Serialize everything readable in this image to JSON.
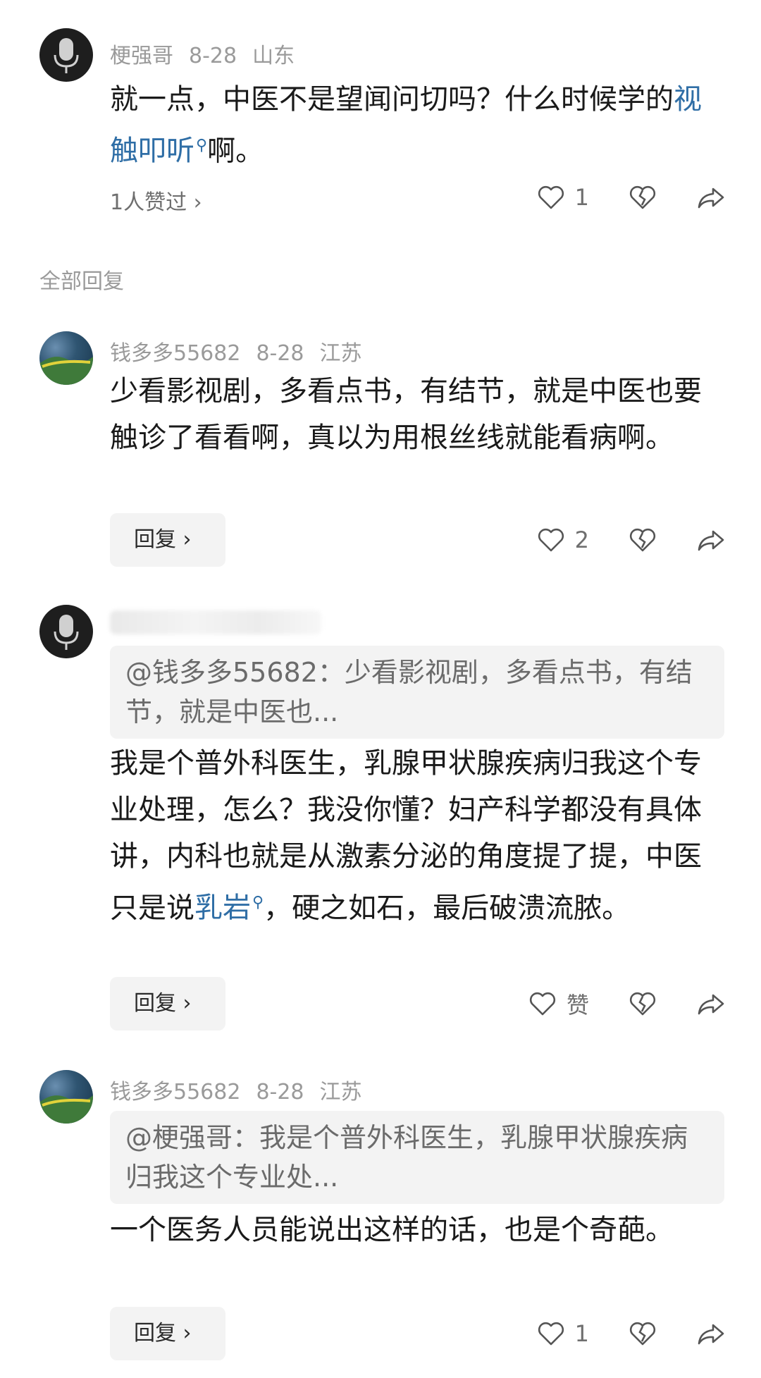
{
  "comments": [
    {
      "author": "梗强哥",
      "date": "8-28",
      "location": "山东",
      "text_pre": "就一点，中医不是望闻问切吗？什么时候学的",
      "link": "视触叩听",
      "text_post": "啊。",
      "likes_line": "1人赞过 ›",
      "like_count": "1"
    },
    {
      "author": "钱多多55682",
      "date": "8-28",
      "location": "江苏",
      "text": "少看影视剧，多看点书，有结节，就是中医也要触诊了看看啊，真以为用根丝线就能看病啊。",
      "reply_label": "回复 ›",
      "like_count": "2"
    },
    {
      "quote": "@钱多多55682：少看影视剧，多看点书，有结节，就是中医也...",
      "text_pre": "我是个普外科医生，乳腺甲状腺疾病归我这个专业处理，怎么？我没你懂？妇产科学都没有具体讲，内科也就是从激素分泌的角度提了提，中医只是说",
      "link": "乳岩",
      "text_post": "，硬之如石，最后破溃流脓。",
      "reply_label": "回复 ›",
      "like_label": "赞"
    },
    {
      "author": "钱多多55682",
      "date": "8-28",
      "location": "江苏",
      "quote": "@梗强哥：我是个普外科医生，乳腺甲状腺疾病归我这个专业处...",
      "text": "一个医务人员能说出这样的话，也是个奇葩。",
      "reply_label": "回复 ›",
      "like_count": "1"
    }
  ],
  "section_label": "全部回复",
  "colors": {
    "link": "#2f6ea6",
    "meta": "#9a9a9a",
    "reply_bg": "#f3f3f3"
  },
  "icons": [
    "microphone-avatar",
    "landscape-avatar",
    "heart-icon",
    "broken-heart-icon",
    "share-icon",
    "search-icon"
  ]
}
